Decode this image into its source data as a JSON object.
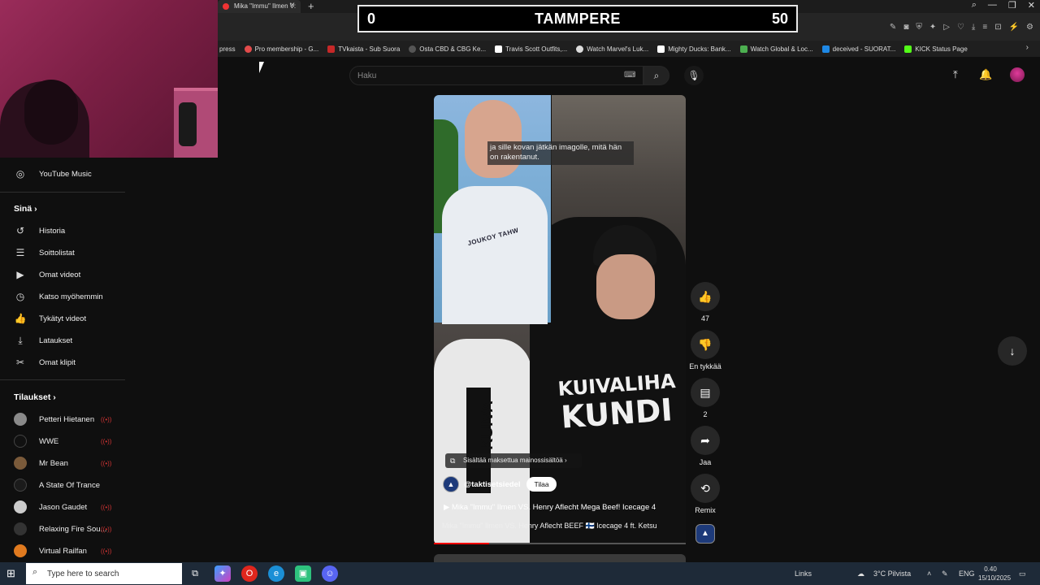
{
  "browser": {
    "active_tab": "Mika \"Immu\" Ilmen V:",
    "bookmarks": [
      {
        "label": "press",
        "color": "#444444"
      },
      {
        "label": "Pro membership - G...",
        "color": "#e34b4b"
      },
      {
        "label": "TVkaista - Sub Suora",
        "color": "#c62828"
      },
      {
        "label": "Osta CBD & CBG Ke...",
        "color": "#555555"
      },
      {
        "label": "Travis Scott Outfits,...",
        "color": "#ffffff"
      },
      {
        "label": "Watch Marvel's Luk...",
        "color": "#dddddd"
      },
      {
        "label": "Mighty Ducks: Bank...",
        "color": "#ffffff"
      },
      {
        "label": "Watch Global & Loc...",
        "color": "#4caf50"
      },
      {
        "label": "deceived - SUORAT...",
        "color": "#1e88e5"
      },
      {
        "label": "KICK Status Page",
        "color": "#53fc18"
      }
    ]
  },
  "score": {
    "left": "0",
    "center": "TAMMPERE",
    "right": "50"
  },
  "sidebar": {
    "youtube_music": "YouTube Music",
    "you_header": "Sinä",
    "you_items": [
      "Historia",
      "Soittolistat",
      "Omat videot",
      "Katso myöhemmin",
      "Tykätyt videot",
      "Lataukset",
      "Omat klipit"
    ],
    "subs_header": "Tilaukset",
    "subscriptions": [
      {
        "label": "Petteri Hietanen",
        "color": "#8a8a8a"
      },
      {
        "label": "WWE",
        "color": "#111111"
      },
      {
        "label": "Mr Bean",
        "color": "#7a5a3a"
      },
      {
        "label": "A State Of Trance",
        "color": "#1b1b1b"
      },
      {
        "label": "Jason Gaudet",
        "color": "#cccccc"
      },
      {
        "label": "Relaxing Fire Sou...",
        "color": "#333333"
      },
      {
        "label": "Virtual Railfan",
        "color": "#e07a1f"
      }
    ]
  },
  "search": {
    "placeholder": "Haku"
  },
  "short": {
    "caption": "ja sille kovan jätkän imagolle, mitä hän on rakentanut.",
    "shirt_text": "JOUKOY TAHW",
    "hoodie_line1": "KUIVALIHA",
    "hoodie_line2": "KUNDI",
    "left_person_text": "KUIVA",
    "sponsor": "Sisältää maksettua mainossisältöä",
    "channel": "@taktisetsiedel",
    "subscribe": "Tilaa",
    "playlist": "Mika \"Immu\" Ilmen VS. Henry Aflecht Mega Beef! Icecage 4",
    "description": "Mika \"Immu\" Ilmen VS. Henry Aflecht BEEF 🇫🇮 Icecage 4 ft. Ketsu",
    "progress": 0.22
  },
  "actions": {
    "likes": "47",
    "dislike": "En tykkää",
    "comments": "2",
    "share": "Jaa",
    "remix": "Remix"
  },
  "taskbar": {
    "search_placeholder": "Type here to search",
    "links": "Links",
    "weather": "3°C Pilvista",
    "lang": "ENG",
    "time": "0.40",
    "date": "15/10/2025"
  }
}
